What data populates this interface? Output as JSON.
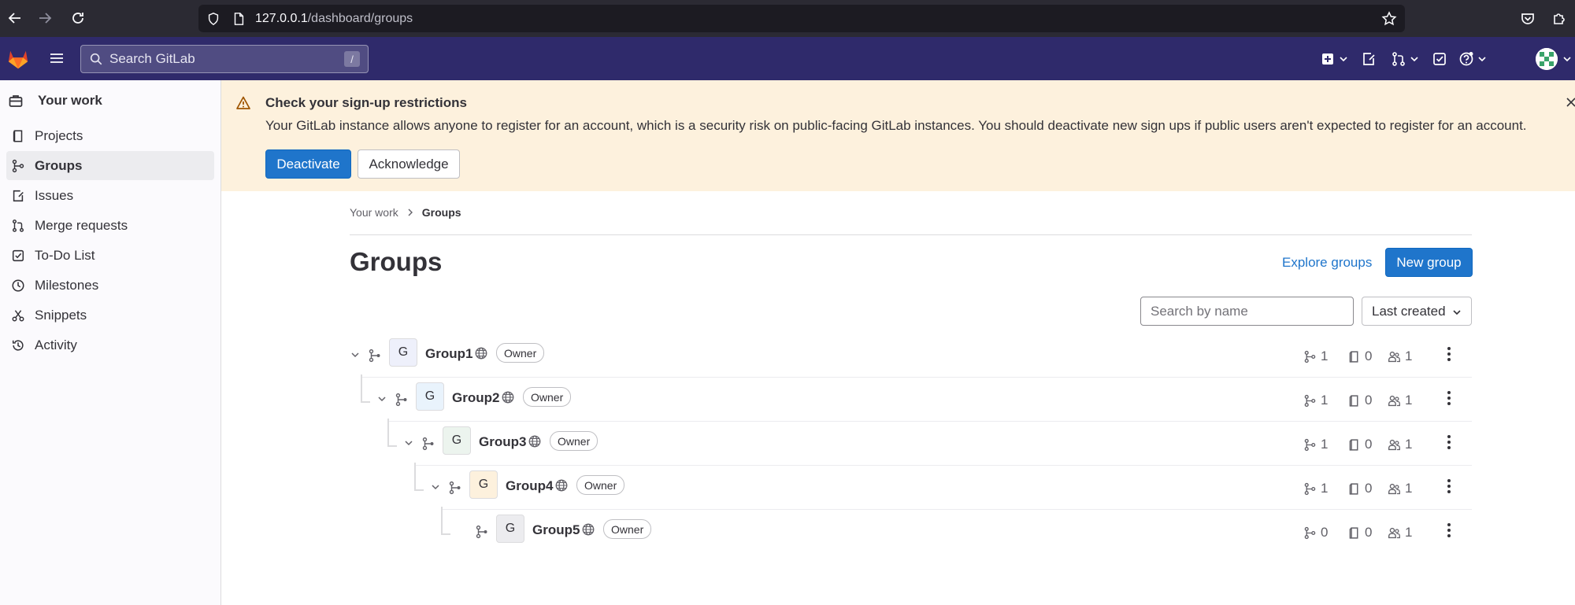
{
  "browser": {
    "url_host": "127.0.0.1",
    "url_path": "/dashboard/groups"
  },
  "topbar": {
    "search_placeholder": "Search GitLab",
    "search_shortcut": "/"
  },
  "sidebar": {
    "header": "Your work",
    "items": [
      {
        "label": "Projects",
        "icon": "project-icon",
        "active": false
      },
      {
        "label": "Groups",
        "icon": "group-icon",
        "active": true
      },
      {
        "label": "Issues",
        "icon": "issues-icon",
        "active": false
      },
      {
        "label": "Merge requests",
        "icon": "merge-request-icon",
        "active": false
      },
      {
        "label": "To-Do List",
        "icon": "todo-icon",
        "active": false
      },
      {
        "label": "Milestones",
        "icon": "milestone-icon",
        "active": false
      },
      {
        "label": "Snippets",
        "icon": "snippet-icon",
        "active": false
      },
      {
        "label": "Activity",
        "icon": "history-icon",
        "active": false
      }
    ]
  },
  "alert": {
    "title": "Check your sign-up restrictions",
    "body": "Your GitLab instance allows anyone to register for an account, which is a security risk on public-facing GitLab instances. You should deactivate new sign ups if public users aren't expected to register for an account.",
    "primary_label": "Deactivate",
    "secondary_label": "Acknowledge"
  },
  "breadcrumb": {
    "parent": "Your work",
    "current": "Groups"
  },
  "page": {
    "title": "Groups",
    "explore_label": "Explore groups",
    "new_group_label": "New group",
    "filter_placeholder": "Search by name",
    "sort_label": "Last created"
  },
  "groups": [
    {
      "name": "Group1",
      "avatar_letter": "G",
      "role": "Owner",
      "subgroups": "1",
      "projects": "0",
      "members": "1",
      "depth": 0,
      "expanded": true,
      "avatar_color": "#eef0fb"
    },
    {
      "name": "Group2",
      "avatar_letter": "G",
      "role": "Owner",
      "subgroups": "1",
      "projects": "0",
      "members": "1",
      "depth": 1,
      "expanded": true,
      "avatar_color": "#e9f3fc"
    },
    {
      "name": "Group3",
      "avatar_letter": "G",
      "role": "Owner",
      "subgroups": "1",
      "projects": "0",
      "members": "1",
      "depth": 2,
      "expanded": true,
      "avatar_color": "#ecf4ee"
    },
    {
      "name": "Group4",
      "avatar_letter": "G",
      "role": "Owner",
      "subgroups": "1",
      "projects": "0",
      "members": "1",
      "depth": 3,
      "expanded": true,
      "avatar_color": "#fdf1dd"
    },
    {
      "name": "Group5",
      "avatar_letter": "G",
      "role": "Owner",
      "subgroups": "0",
      "projects": "0",
      "members": "1",
      "depth": 4,
      "expanded": false,
      "avatar_color": "#ececef"
    }
  ],
  "colors": {
    "topbar": "#2f2a6b",
    "primary": "#1f75cb",
    "alert_bg": "#fdf1dd"
  }
}
